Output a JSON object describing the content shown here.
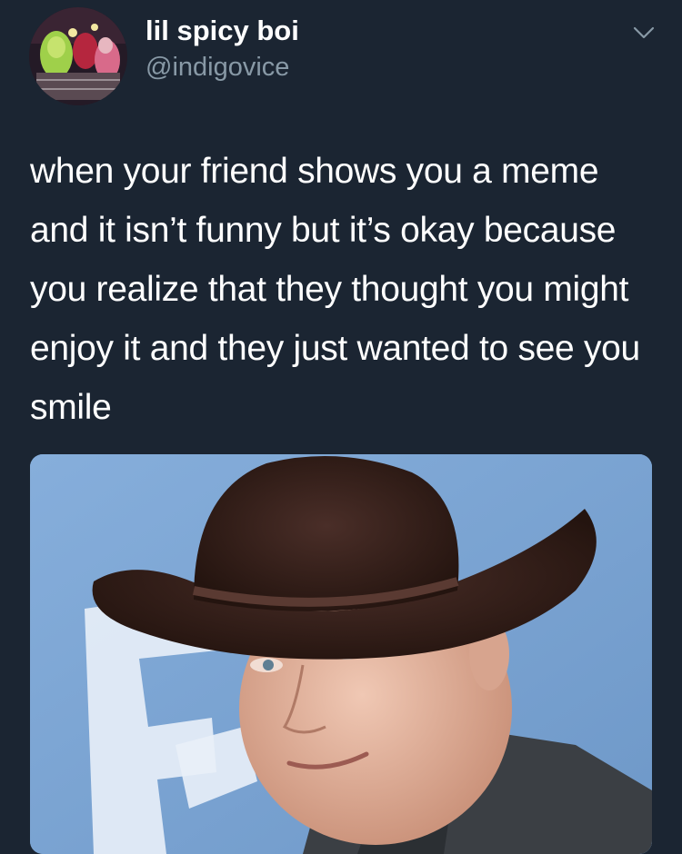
{
  "tweet": {
    "author": {
      "display_name": "lil spicy boi",
      "handle": "@indigovice"
    },
    "menu_icon": "chevron-down-icon",
    "text": "when your friend shows you a meme and it isn’t funny but it’s okay because you realize that they thought you might enjoy it and they just wanted to see you smile"
  },
  "colors": {
    "background": "#1b2532",
    "handle_gray": "#8899a6",
    "text": "#ffffff"
  }
}
